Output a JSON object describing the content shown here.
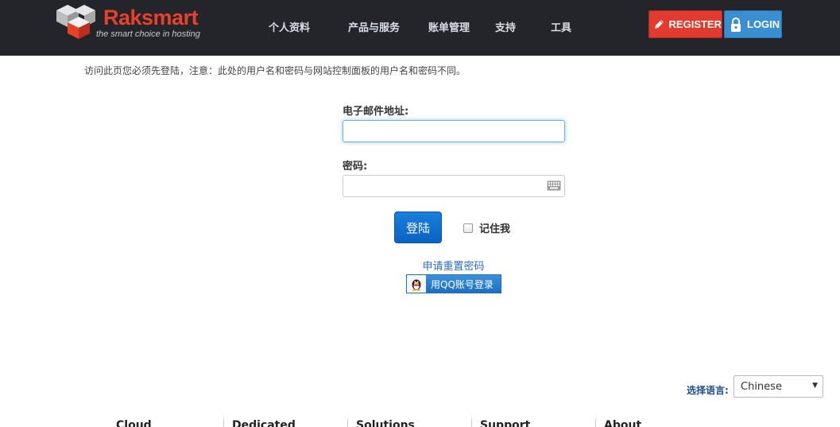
{
  "header": {
    "logo": {
      "name": "Raksmart",
      "tagline": "the smart choice in hosting"
    },
    "nav": [
      "个人资料",
      "产品与服务",
      "账单管理",
      "支持",
      "工具"
    ],
    "register_label": "REGISTER",
    "login_label": "LOGIN",
    "colors": {
      "bar": "#23252b",
      "register": "#e23a2e",
      "login": "#3a8fd2",
      "brand": "#e8412b"
    }
  },
  "notice": "访问此页您必须先登陆，注意：此处的用户名和密码与网站控制面板的用户名和密码不同。",
  "form": {
    "email_label": "电子邮件地址:",
    "email_value": "",
    "password_label": "密码:",
    "password_value": "",
    "submit_label": "登陆",
    "remember_label": "记住我",
    "remember_checked": false,
    "forgot_link": "申请重置密码",
    "qq_button": "用QQ账号登录"
  },
  "language": {
    "label": "选择语言:",
    "selected": "Chinese"
  },
  "footer": {
    "columns": [
      "Cloud",
      "Dedicated",
      "Solutions",
      "Support",
      "About"
    ]
  }
}
